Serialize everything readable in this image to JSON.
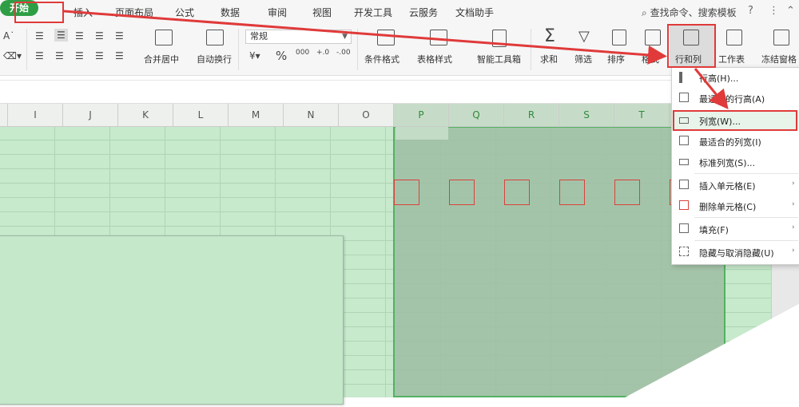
{
  "menu": {
    "tabs": [
      "开始",
      "插入",
      "页面布局",
      "公式",
      "数据",
      "审阅",
      "视图",
      "开发工具",
      "云服务",
      "文档助手"
    ],
    "search_placeholder": "查找命令、搜索模板"
  },
  "ribbon": {
    "merge_label": "合并居中",
    "wrap_label": "自动换行",
    "number_format": "常规",
    "currency_symbol": "¥",
    "percent_symbol": "%",
    "conditional_format": "条件格式",
    "table_style": "表格样式",
    "smart_toolbox": "智能工具箱",
    "sum": "求和",
    "filter": "筛选",
    "sort": "排序",
    "format": "格式",
    "row_col": "行和列",
    "worksheet": "工作表",
    "freeze": "冻结窗格"
  },
  "columns": [
    "I",
    "J",
    "K",
    "L",
    "M",
    "N",
    "O",
    "P",
    "Q",
    "R",
    "S",
    "T"
  ],
  "dropdown": {
    "items": [
      {
        "label": "行高(H)..."
      },
      {
        "label": "最适合的行高(A)"
      },
      {
        "label": "列宽(W)..."
      },
      {
        "label": "最适合的列宽(I)"
      },
      {
        "label": "标准列宽(S)..."
      },
      {
        "label": "插入单元格(E)"
      },
      {
        "label": "删除单元格(C)"
      },
      {
        "label": "填充(F)"
      },
      {
        "label": "隐藏与取消隐藏(U)"
      }
    ]
  },
  "colors": {
    "accent": "#2e9e45",
    "highlight": "#e03a3a",
    "grid": "#c7e9cc",
    "selection": "#9fbea4"
  }
}
